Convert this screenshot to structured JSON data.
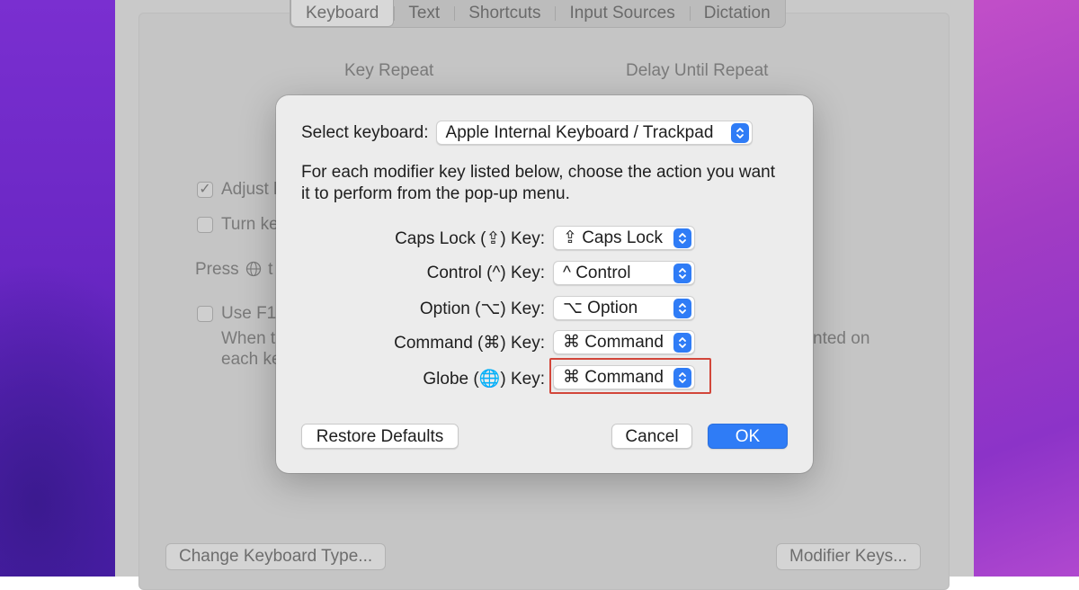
{
  "tabs": [
    {
      "label": "Keyboard",
      "active": true
    },
    {
      "label": "Text"
    },
    {
      "label": "Shortcuts"
    },
    {
      "label": "Input Sources"
    },
    {
      "label": "Dictation"
    }
  ],
  "background_pane": {
    "key_repeat_label": "Key Repeat",
    "delay_label": "Delay Until Repeat",
    "adjust_text": "Adjust k",
    "turn_text": "Turn ke",
    "press_text": "Press",
    "press_text_after": "t",
    "use_f1_text": "Use F1,",
    "when_text": "When t",
    "each_text": "each ke",
    "printed_on_text": "nted on",
    "change_keyboard_button": "Change Keyboard Type...",
    "modifier_keys_button": "Modifier Keys..."
  },
  "dialog": {
    "select_label": "Select keyboard:",
    "keyboard_value": "Apple Internal Keyboard / Trackpad",
    "description": "For each modifier key listed below, choose the action you want it to perform from the pop-up menu.",
    "modifiers": [
      {
        "label": "Caps Lock (⇪) Key:",
        "value": "⇪ Caps Lock"
      },
      {
        "label": "Control (^) Key:",
        "value": "^ Control"
      },
      {
        "label": "Option (⌥) Key:",
        "value": "⌥ Option"
      },
      {
        "label": "Command (⌘) Key:",
        "value": "⌘ Command"
      },
      {
        "label": "Globe (🌐) Key:",
        "value": "⌘ Command",
        "highlighted": true
      }
    ],
    "restore_button": "Restore Defaults",
    "cancel_button": "Cancel",
    "ok_button": "OK"
  },
  "colors": {
    "accent": "#2f7cf6",
    "highlight_border": "#d2463a"
  }
}
